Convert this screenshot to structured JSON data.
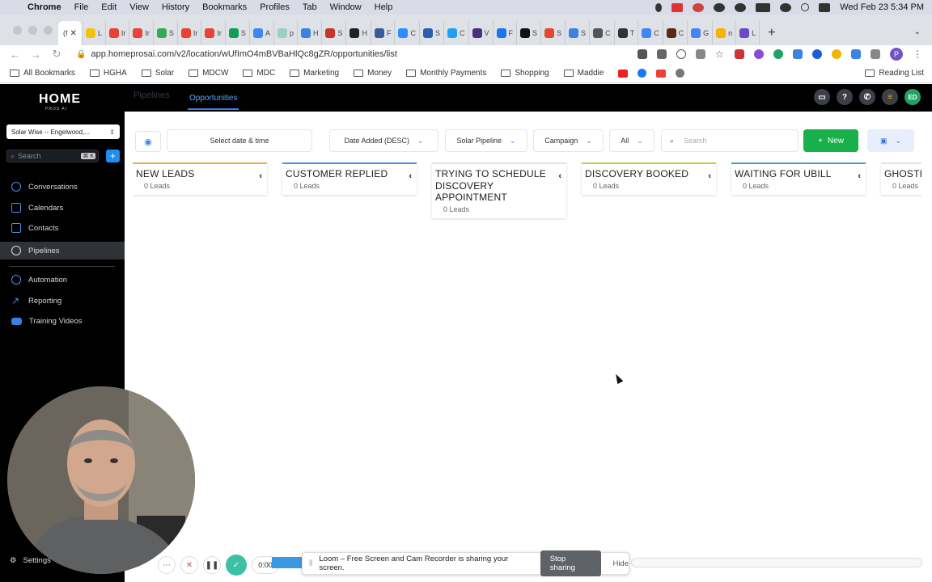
{
  "menubar": {
    "app": "Chrome",
    "items": [
      "File",
      "Edit",
      "View",
      "History",
      "Bookmarks",
      "Profiles",
      "Tab",
      "Window",
      "Help"
    ],
    "datetime": "Wed Feb 23  5:34 PM"
  },
  "tabs": {
    "active_label": "(f",
    "others": [
      "L",
      "Ir",
      "Ir",
      "S",
      "Ir",
      "Ir",
      "S",
      "A",
      "p",
      "H",
      "S",
      "H",
      "F",
      "C",
      "S",
      "C",
      "V",
      "F",
      "S",
      "S",
      "S",
      "C",
      "T",
      "C",
      "C",
      "G",
      "n",
      "L"
    ]
  },
  "toolbar": {
    "url": "app.homeprosai.com/v2/location/wUfImO4mBVBaHlQc8gZR/opportunities/list"
  },
  "bookmarks": {
    "items": [
      "All Bookmarks",
      "HGHA",
      "Solar",
      "MDCW",
      "MDC",
      "Marketing",
      "Money",
      "Monthly Payments",
      "Shopping",
      "Maddie"
    ],
    "reading_list": "Reading List"
  },
  "header": {
    "logo": "HOME",
    "logo_sub": "PROS AI",
    "tab_pipelines": "Pipelines",
    "tab_opportunities": "Opportunities",
    "user_initials": "ED"
  },
  "sidebar": {
    "location": "Solar Wise -- Engelwood,...",
    "search_placeholder": "Search",
    "search_shortcut": "⌘ K",
    "items": [
      {
        "label": "Conversations",
        "icon": "chat-icon"
      },
      {
        "label": "Calendars",
        "icon": "calendar-icon"
      },
      {
        "label": "Contacts",
        "icon": "contacts-icon"
      },
      {
        "label": "Pipelines",
        "icon": "pipeline-icon"
      },
      {
        "label": "Automation",
        "icon": "automation-icon"
      },
      {
        "label": "Reporting",
        "icon": "chart-icon"
      },
      {
        "label": "Training Videos",
        "icon": "youtube-icon"
      }
    ],
    "settings": "Settings"
  },
  "filters": {
    "date": "Select date & time",
    "sort": "Date Added (DESC)",
    "pipeline": "Solar Pipeline",
    "campaign": "Campaign",
    "status": "All",
    "search_placeholder": "Search",
    "new_label": "New"
  },
  "columns": [
    {
      "title": "NEW LEADS",
      "count": "0 Leads",
      "color": "#f2a93b"
    },
    {
      "title": "CUSTOMER REPLIED",
      "count": "0 Leads",
      "color": "#4a90e2"
    },
    {
      "title": "TRYING TO SCHEDULE DISCOVERY APPOINTMENT",
      "count": "0 Leads",
      "color": "#e0e0e0"
    },
    {
      "title": "DISCOVERY BOOKED",
      "count": "0 Leads",
      "color": "#b8d43a"
    },
    {
      "title": "WAITING FOR UBILL",
      "count": "0 Leads",
      "color": "#46a0c8"
    },
    {
      "title": "GHOSTI",
      "count": "0 Leads",
      "color": "#e0e0e0"
    }
  ],
  "loom": {
    "timer": "0:00",
    "message": "Loom – Free Screen and Cam Recorder is sharing your screen.",
    "stop": "Stop sharing",
    "hide": "Hide"
  }
}
